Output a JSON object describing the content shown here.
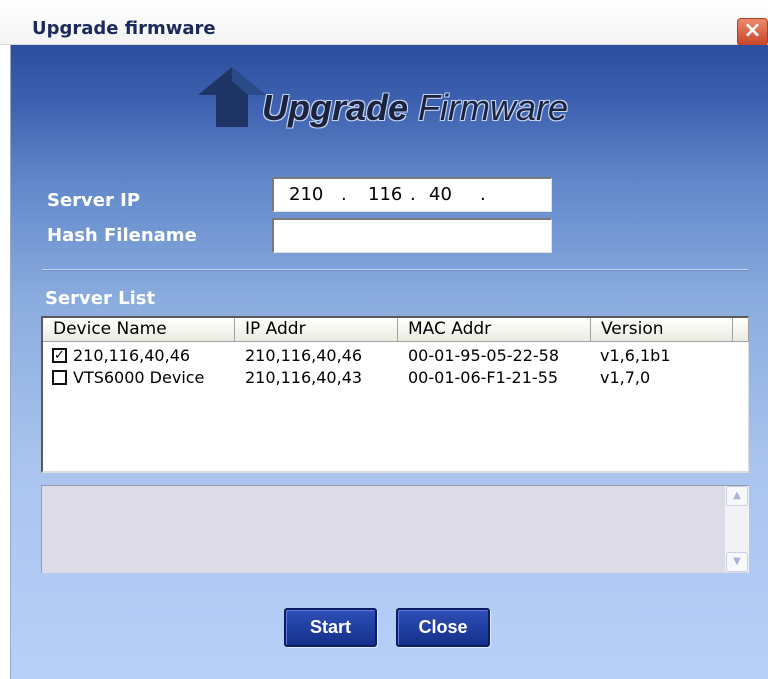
{
  "window": {
    "title": "Upgrade firmware",
    "close_glyph": "×"
  },
  "header": {
    "title_bold": "Upgrade",
    "title_regular": " Firmware",
    "icon": "up-arrow-icon"
  },
  "form": {
    "server_ip_label": "Server IP",
    "ip_octets": [
      "210",
      "116",
      "40",
      ""
    ],
    "ip_separator": ".",
    "hash_filename_label": "Hash Filename",
    "hash_filename_value": ""
  },
  "server_list": {
    "label": "Server List",
    "columns": [
      "Device Name",
      "IP Addr",
      "MAC Addr",
      "Version"
    ],
    "rows": [
      {
        "checked": true,
        "check_glyph": "✓",
        "device": "210,116,40,46",
        "ip": "210,116,40,46",
        "mac": "00-01-95-05-22-58",
        "version": "v1,6,1b1"
      },
      {
        "checked": false,
        "check_glyph": "",
        "device": "VTS6000 Device",
        "ip": "210,116,40,43",
        "mac": "00-01-06-F1-21-55",
        "version": "v1,7,0"
      }
    ]
  },
  "log": {
    "text": "",
    "scroll_up": "▲",
    "scroll_down": "▼"
  },
  "buttons": {
    "start": "Start",
    "close": "Close"
  },
  "colors": {
    "accent": "#1a3690",
    "title_text": "#1b2a5a",
    "close_red": "#c9452a"
  }
}
